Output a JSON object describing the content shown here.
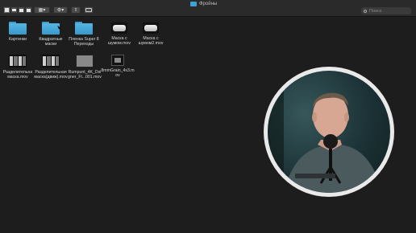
{
  "window": {
    "title": "Фройны"
  },
  "toolbar": {
    "sort_label": "▾",
    "tag_label": ""
  },
  "search": {
    "placeholder": "Поиск"
  },
  "files": [
    {
      "name": "Картинки",
      "kind": "folder"
    },
    {
      "name": "Квадратные\nмаски",
      "kind": "folder"
    },
    {
      "name": "Пленка Super 8\nПереходы",
      "kind": "folder"
    },
    {
      "name": "Маска с\nшумом.mov",
      "kind": "movie-pill"
    },
    {
      "name": "Маска с\nшумом2.mov",
      "kind": "movie-pill"
    },
    {
      "name": "Разделительна\nмаска.mov",
      "kind": "strip"
    },
    {
      "name": "Разделительная\nмаска(движ).mov",
      "kind": "strip"
    },
    {
      "name": "Rumpunt_4K_Dsi\ngner_Fl...001.mov",
      "kind": "clip"
    },
    {
      "name": "8mmGrain_4x3.m\nov",
      "kind": "clip-small"
    }
  ],
  "webcam": {
    "description_icon": "person-video"
  }
}
